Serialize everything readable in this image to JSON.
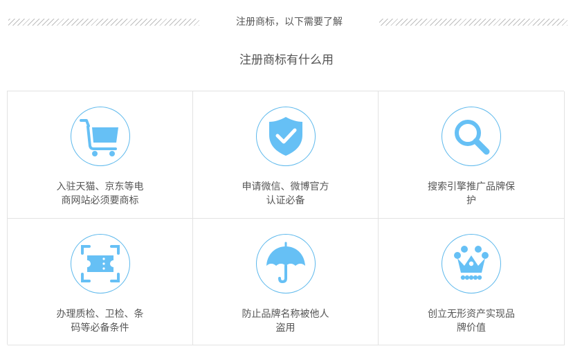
{
  "header": {
    "title": "注册商标，以下需要了解"
  },
  "section": {
    "title": "注册商标有什么用"
  },
  "accent_color": "#66c0f5",
  "items": [
    {
      "icon": "shopping-cart-icon",
      "line1": "入驻天猫、京东等电",
      "line2": "商网站必须要商标"
    },
    {
      "icon": "shield-check-icon",
      "line1": "申请微信、微博官方",
      "line2": "认证必备"
    },
    {
      "icon": "magnifier-icon",
      "line1": "搜索引擎推广品牌保",
      "line2": "护"
    },
    {
      "icon": "scan-ticket-icon",
      "line1": "办理质检、卫检、条",
      "line2": "码等必备条件"
    },
    {
      "icon": "umbrella-icon",
      "line1": "防止品牌名称被他人",
      "line2": "盗用"
    },
    {
      "icon": "crown-icon",
      "line1": "创立无形资产实现品",
      "line2": "牌价值"
    }
  ]
}
